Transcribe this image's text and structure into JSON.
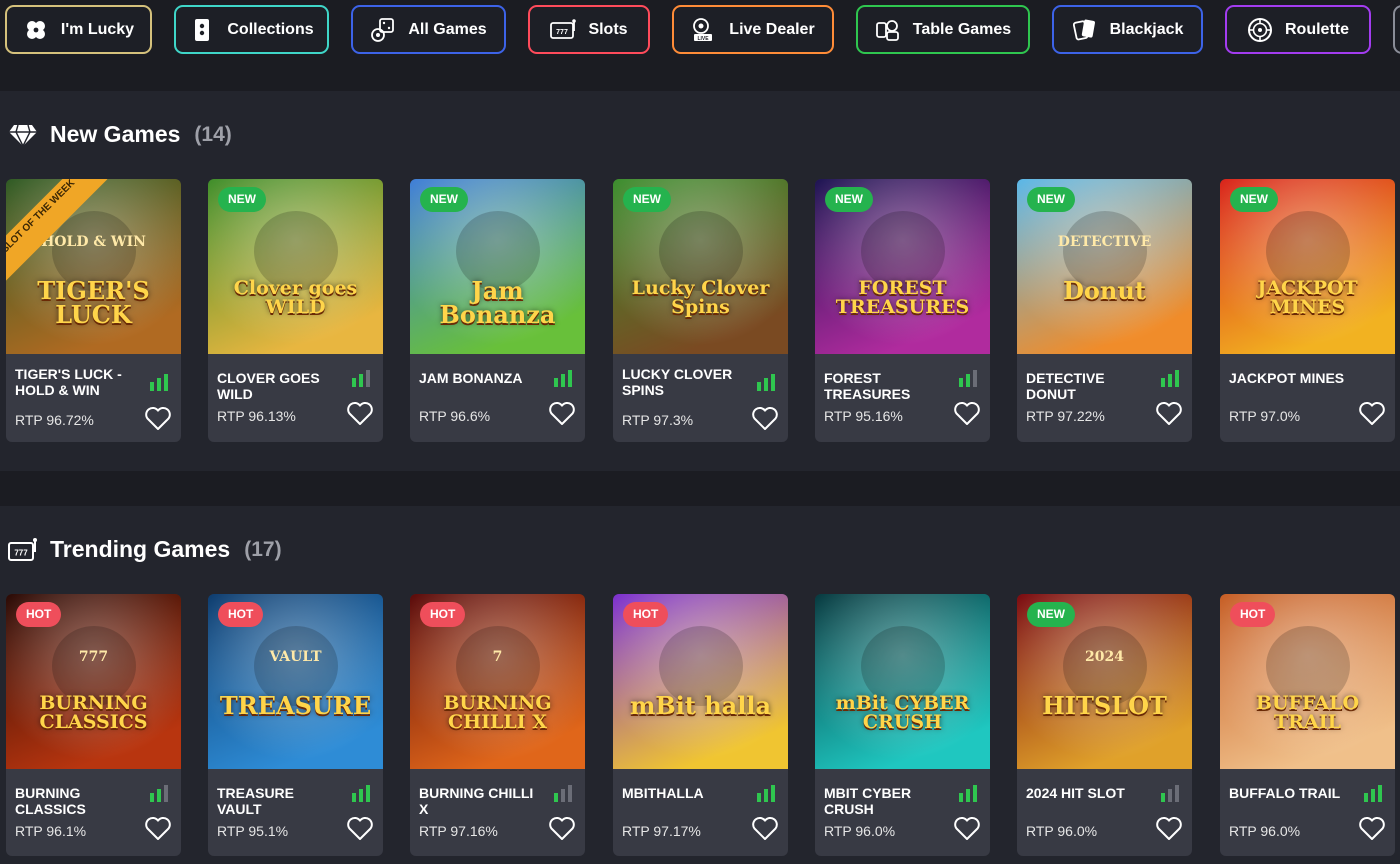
{
  "categories": [
    {
      "label": "I'm Lucky",
      "icon": "clover-icon",
      "color": "#d5c17c"
    },
    {
      "label": "Collections",
      "icon": "cards-icon",
      "color": "#3fd6c8"
    },
    {
      "label": "All Games",
      "icon": "dice-icon",
      "color": "#3d63e8"
    },
    {
      "label": "Slots",
      "icon": "slot-777-icon",
      "color": "#ff4b5b"
    },
    {
      "label": "Live Dealer",
      "icon": "live-camera-icon",
      "color": "#ff8c38"
    },
    {
      "label": "Table Games",
      "icon": "table-games-icon",
      "color": "#2fc64f"
    },
    {
      "label": "Blackjack",
      "icon": "blackjack-cards-icon",
      "color": "#3d63e8"
    },
    {
      "label": "Roulette",
      "icon": "roulette-icon",
      "color": "#a33cf0"
    }
  ],
  "sections": [
    {
      "title": "New Games",
      "count": "(14)",
      "icon": "diamond-icon",
      "games": [
        {
          "title": "Tiger's Luck - Hold & Win",
          "art_text": "TIGER'S LUCK",
          "art_sub": "HOLD & WIN",
          "badge": "",
          "ribbon": "SLOT OF THE WEEK",
          "rtp": "RTP 96.72%",
          "bars": 3,
          "colors": [
            "#2f5b24",
            "#b06a22"
          ]
        },
        {
          "title": "Clover Goes Wild",
          "art_text": "Clover goes WILD",
          "art_sub": "",
          "badge": "NEW",
          "ribbon": "",
          "rtp": "RTP 96.13%",
          "bars": 2,
          "colors": [
            "#3f8e2a",
            "#e8b640"
          ]
        },
        {
          "title": "Jam Bonanza",
          "art_text": "Jam Bonanza",
          "art_sub": "",
          "badge": "NEW",
          "ribbon": "",
          "rtp": "RTP 96.6%",
          "bars": 3,
          "colors": [
            "#3f7ed8",
            "#68c03a"
          ]
        },
        {
          "title": "Lucky Clover Spins",
          "art_text": "Lucky Clover Spins",
          "art_sub": "",
          "badge": "NEW",
          "ribbon": "",
          "rtp": "RTP 97.3%",
          "bars": 3,
          "colors": [
            "#3c8e2e",
            "#7a4a22"
          ]
        },
        {
          "title": "Forest Treasures",
          "art_text": "FOREST TREASURES",
          "art_sub": "",
          "badge": "NEW",
          "ribbon": "",
          "rtp": "RTP 95.16%",
          "bars": 2,
          "colors": [
            "#1d1452",
            "#b02b9e"
          ]
        },
        {
          "title": "Detective Donut",
          "art_text": "Donut",
          "art_sub": "DETECTIVE",
          "badge": "NEW",
          "ribbon": "",
          "rtp": "RTP 97.22%",
          "bars": 3,
          "colors": [
            "#5ab7e8",
            "#f08c2a"
          ]
        },
        {
          "title": "Jackpot Mines",
          "art_text": "JACKPOT MINES",
          "art_sub": "",
          "badge": "NEW",
          "ribbon": "",
          "rtp": "RTP 97.0%",
          "bars": 0,
          "colors": [
            "#d9231a",
            "#f2b221"
          ]
        }
      ]
    },
    {
      "title": "Trending Games",
      "count": "(17)",
      "icon": "slot-machine-icon",
      "games": [
        {
          "title": "Burning Classics",
          "art_text": "BURNING CLASSICS",
          "art_sub": "777",
          "badge": "HOT",
          "ribbon": "",
          "rtp": "RTP 96.1%",
          "bars": 2,
          "colors": [
            "#2a0a05",
            "#b8350f"
          ]
        },
        {
          "title": "Treasure Vault",
          "art_text": "TREASURE",
          "art_sub": "VAULT",
          "badge": "HOT",
          "ribbon": "",
          "rtp": "RTP 95.1%",
          "bars": 3,
          "colors": [
            "#0d3c6e",
            "#2e8cd6"
          ]
        },
        {
          "title": "Burning Chilli X",
          "art_text": "BURNING CHILLI X",
          "art_sub": "7",
          "badge": "HOT",
          "ribbon": "",
          "rtp": "RTP 97.16%",
          "bars": 1,
          "colors": [
            "#5a0a0a",
            "#e0661a"
          ]
        },
        {
          "title": "mBithalla",
          "art_text": "mBit halla",
          "art_sub": "",
          "badge": "HOT",
          "ribbon": "",
          "rtp": "RTP 97.17%",
          "bars": 3,
          "colors": [
            "#7b2fd0",
            "#f0c531"
          ]
        },
        {
          "title": "mBit Cyber Crush",
          "art_text": "mBit CYBER CRUSH",
          "art_sub": "",
          "badge": "",
          "ribbon": "",
          "rtp": "RTP 96.0%",
          "bars": 3,
          "colors": [
            "#06393f",
            "#1fc7c0"
          ]
        },
        {
          "title": "2024 Hit Slot",
          "art_text": "HITSLOT",
          "art_sub": "2024",
          "badge": "NEW",
          "ribbon": "",
          "rtp": "RTP 96.0%",
          "bars": 1,
          "colors": [
            "#7a0a10",
            "#e0a12a"
          ]
        },
        {
          "title": "Buffalo Trail",
          "art_text": "BUFFALO TRAIL",
          "art_sub": "",
          "badge": "HOT",
          "ribbon": "",
          "rtp": "RTP 96.0%",
          "bars": 3,
          "colors": [
            "#c65d24",
            "#f0c08a"
          ]
        }
      ]
    }
  ]
}
